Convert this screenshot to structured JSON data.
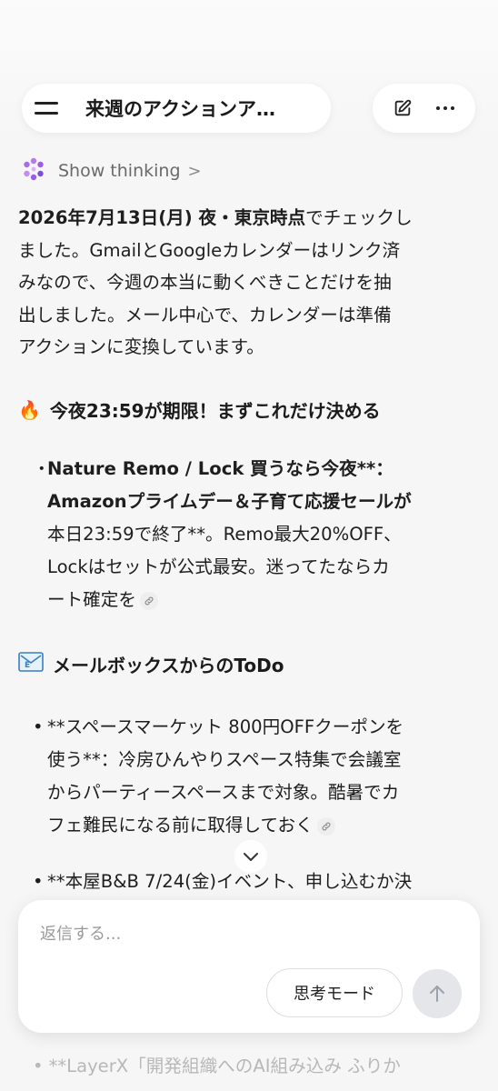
{
  "header": {
    "title": "来週のアクションア…",
    "menu_icon": "hamburger-icon",
    "edit_icon": "edit-icon",
    "more_icon": "more-horizontal-icon"
  },
  "thinking": {
    "label": "Show thinking",
    "chevron": ">"
  },
  "intro": {
    "bold": "2026年7月13日(月) 夜・東京時点",
    "line1_rest": "でチェックし",
    "line2": "ました。GmailとGoogleカレンダーはリンク済",
    "line3": "みなので、今週の本当に動くべきことだけを抽",
    "line4": "出しました。メール中心で、カレンダーは準備",
    "line5": "アクションに変換しています。"
  },
  "section1": {
    "emoji": "🔥",
    "title": "今夜23:59が期限！まずこれだけ決める",
    "bullet": {
      "dot": "・",
      "bold1": "Nature Remo / Lock 買うなら今夜**：",
      "bold2": "Amazonプライムデー＆子育て応援セールが",
      "line3": "本日23:59で終了**。Remo最大20%OFF、",
      "line4": "Lockはセットが公式最安。迷ってたならカ",
      "line5": "ート確定を"
    }
  },
  "section2": {
    "emoji": "📧",
    "title": "メールボックスからのToDo",
    "bullet1": {
      "dot": "•",
      "line1": "**スペースマーケット 800円OFFクーポンを",
      "line2": "使う**：冷房ひんやりスペース特集で会議室",
      "line3": "からパーティースペースまで対象。酷暑でカ",
      "line4": "フェ難民になる前に取得しておく"
    },
    "bullet2": {
      "dot": "•",
      "line1": "**本屋B&B 7/24(金)イベント、申し込むか決"
    }
  },
  "composer": {
    "placeholder": "返信する...",
    "mode_label": "思考モード",
    "send_icon": "arrow-up-icon"
  },
  "peek": {
    "dot": "•",
    "text": "**LayerX「開発組織へのAI組み込み ふりか"
  },
  "colors": {
    "background": "#f6f6f6",
    "text": "#1e1e1e",
    "muted": "#6a6a6a",
    "sparkle_purple": "#9b5de5"
  }
}
